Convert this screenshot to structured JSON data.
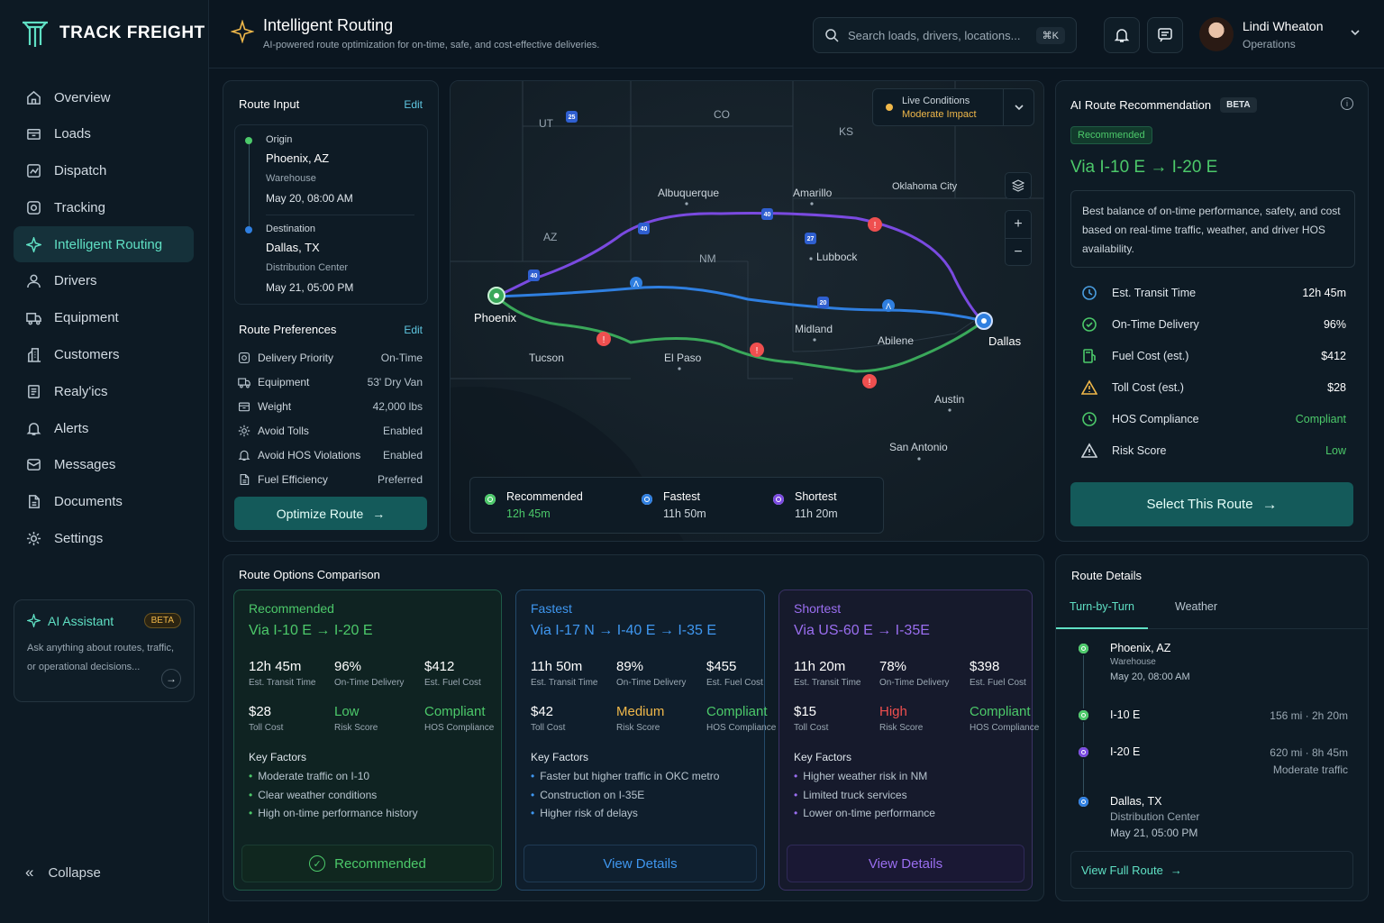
{
  "brand": {
    "name": "TRACK FREIGHT"
  },
  "sidebar": {
    "items": [
      {
        "label": "Overview",
        "icon": "home-icon"
      },
      {
        "label": "Loads",
        "icon": "box-icon"
      },
      {
        "label": "Dispatch",
        "icon": "dispatch-icon"
      },
      {
        "label": "Tracking",
        "icon": "target-icon"
      },
      {
        "label": "Intelligent Routing",
        "icon": "sparkle-icon",
        "active": true
      },
      {
        "label": "Drivers",
        "icon": "users-icon"
      },
      {
        "label": "Equipment",
        "icon": "truck-icon"
      },
      {
        "label": "Customers",
        "icon": "building-icon"
      },
      {
        "label": "Realy'ics",
        "icon": "report-icon"
      },
      {
        "label": "Alerts",
        "icon": "bell-icon"
      },
      {
        "label": "Messages",
        "icon": "mail-icon"
      },
      {
        "label": "Documents",
        "icon": "document-icon"
      },
      {
        "label": "Settings",
        "icon": "gear-icon"
      }
    ],
    "assistant": {
      "title": "AI Assistant",
      "badge": "BETA",
      "desc": "Ask anything about routes, traffic, or operational decisions..."
    },
    "collapse_label": "Collapse"
  },
  "header": {
    "title": "Intelligent Routing",
    "subtitle": "AI-powered route optimization for on-time, safe, and cost-effective deliveries.",
    "search_placeholder": "Search loads, drivers, locations...",
    "search_shortcut": "⌘K",
    "user": {
      "name": "Lindi Wheaton",
      "role": "Operations"
    }
  },
  "route_input": {
    "title": "Route Input",
    "edit": "Edit",
    "origin": {
      "label": "Origin",
      "city": "Phoenix, AZ",
      "type": "Warehouse",
      "time": "May 20, 08:00 AM"
    },
    "destination": {
      "label": "Destination",
      "city": "Dallas, TX",
      "type": "Distribution Center",
      "time": "May 21, 05:00 PM"
    }
  },
  "preferences": {
    "title": "Route Preferences",
    "edit": "Edit",
    "rows": [
      {
        "label": "Delivery Priority",
        "value": "On-Time"
      },
      {
        "label": "Equipment",
        "value": "53' Dry Van"
      },
      {
        "label": "Weight",
        "value": "42,000 lbs"
      },
      {
        "label": "Avoid Tolls",
        "value": "Enabled"
      },
      {
        "label": "Avoid HOS Violations",
        "value": "Enabled"
      },
      {
        "label": "Fuel Efficiency",
        "value": "Preferred"
      }
    ],
    "button": "Optimize Route"
  },
  "map": {
    "live": {
      "title": "Live Conditions",
      "status": "Moderate Impact"
    },
    "states": [
      "UT",
      "CO",
      "KS",
      "AZ",
      "NM"
    ],
    "cities": [
      "Phoenix",
      "Dallas",
      "Albuquerque",
      "Amarillo",
      "Oklahoma City",
      "Lubbock",
      "Midland",
      "Abilene",
      "Tucson",
      "El Paso",
      "Austin",
      "San Antonio"
    ],
    "highways": [
      "25",
      "40",
      "40",
      "27",
      "40",
      "20"
    ],
    "legend": [
      {
        "name": "Recommended",
        "time": "12h 45m",
        "color": "#4cc96a"
      },
      {
        "name": "Fastest",
        "time": "11h 50m",
        "color": "#2f7fe0"
      },
      {
        "name": "Shortest",
        "time": "11h 20m",
        "color": "#7a4ae0"
      }
    ]
  },
  "recommendation": {
    "title": "AI Route Recommendation",
    "badge": "BETA",
    "tag": "Recommended",
    "route": "Via I-10 E → I-20 E",
    "desc": "Best balance of on-time performance, safety, and cost based on real-time traffic, weather, and driver HOS availability.",
    "metrics": [
      {
        "label": "Est. Transit Time",
        "value": "12h 45m",
        "icon": "clock-icon",
        "color": "#4a9ee0",
        "vcolor": "#ffffff"
      },
      {
        "label": "On-Time Delivery",
        "value": "96%",
        "icon": "check-circle-icon",
        "color": "#4cc96a",
        "vcolor": "#ffffff"
      },
      {
        "label": "Fuel Cost (est.)",
        "value": "$412",
        "icon": "fuel-icon",
        "color": "#4cc96a",
        "vcolor": "#ffffff"
      },
      {
        "label": "Toll Cost (est.)",
        "value": "$28",
        "icon": "warning-icon",
        "color": "#f0b84a",
        "vcolor": "#ffffff"
      },
      {
        "label": "HOS Compliance",
        "value": "Compliant",
        "icon": "clock-icon",
        "color": "#4cc96a",
        "vcolor": "#4cc96a"
      },
      {
        "label": "Risk Score",
        "value": "Low",
        "icon": "warning-icon",
        "color": "#cdd6dd",
        "vcolor": "#4cc96a"
      }
    ],
    "button": "Select This Route"
  },
  "comparison": {
    "title": "Route Options Comparison",
    "options": [
      {
        "label": "Recommended",
        "route": "Via I-10 E → I-20 E",
        "stats": [
          {
            "value": "12h 45m",
            "label": "Est. Transit Time",
            "color": "#ffffff"
          },
          {
            "value": "96%",
            "label": "On-Time Delivery",
            "color": "#ffffff"
          },
          {
            "value": "$412",
            "label": "Est. Fuel Cost",
            "color": "#ffffff"
          },
          {
            "value": "$28",
            "label": "Toll Cost",
            "color": "#ffffff"
          },
          {
            "value": "Low",
            "label": "Risk Score",
            "color": "#4cc96a"
          },
          {
            "value": "Compliant",
            "label": "HOS Compliance",
            "color": "#4cc96a"
          }
        ],
        "key_title": "Key Factors",
        "factors": [
          "Moderate traffic on I-10",
          "Clear weather conditions",
          "High on-time performance history"
        ],
        "button": "Recommended"
      },
      {
        "label": "Fastest",
        "route": "Via I-17 N → I-40 E → I-35 E",
        "stats": [
          {
            "value": "11h 50m",
            "label": "Est. Transit Time",
            "color": "#ffffff"
          },
          {
            "value": "89%",
            "label": "On-Time Delivery",
            "color": "#ffffff"
          },
          {
            "value": "$455",
            "label": "Est. Fuel Cost",
            "color": "#ffffff"
          },
          {
            "value": "$42",
            "label": "Toll Cost",
            "color": "#ffffff"
          },
          {
            "value": "Medium",
            "label": "Risk Score",
            "color": "#f0b84a"
          },
          {
            "value": "Compliant",
            "label": "HOS Compliance",
            "color": "#4cc96a"
          }
        ],
        "key_title": "Key Factors",
        "factors": [
          "Faster but higher traffic in OKC metro",
          "Construction on I-35E",
          "Higher risk of delays"
        ],
        "button": "View Details"
      },
      {
        "label": "Shortest",
        "route": "Via US-60 E → I-35E",
        "stats": [
          {
            "value": "11h 20m",
            "label": "Est. Transit Time",
            "color": "#ffffff"
          },
          {
            "value": "78%",
            "label": "On-Time Delivery",
            "color": "#ffffff"
          },
          {
            "value": "$398",
            "label": "Est. Fuel Cost",
            "color": "#ffffff"
          },
          {
            "value": "$15",
            "label": "Toll Cost",
            "color": "#ffffff"
          },
          {
            "value": "High",
            "label": "Risk Score",
            "color": "#ef4f4f"
          },
          {
            "value": "Compliant",
            "label": "HOS Compliance",
            "color": "#4cc96a"
          }
        ],
        "key_title": "Key Factors",
        "factors": [
          "Higher weather risk in NM",
          "Limited truck services",
          "Lower on-time performance"
        ],
        "button": "View Details"
      }
    ]
  },
  "route_details": {
    "title": "Route Details",
    "tabs": [
      "Turn-by-Turn",
      "Weather"
    ],
    "stops": [
      {
        "name": "Phoenix, AZ",
        "sub": "Warehouse",
        "time": "May 20, 08:00 AM",
        "right": "",
        "right2": "",
        "color": "#4cc96a"
      },
      {
        "name": "I-10 E",
        "sub": "",
        "time": "",
        "right": "156 mi · 2h 20m",
        "right2": "",
        "color": "#4cc96a"
      },
      {
        "name": "I-20 E",
        "sub": "",
        "time": "",
        "right": "620 mi · 8h 45m",
        "right2": "Moderate traffic",
        "color": "#7a4ae0"
      },
      {
        "name": "Dallas, TX",
        "sub": "Distribution Center",
        "time": "May 21, 05:00 PM",
        "right": "",
        "right2": "",
        "color": "#2f7fe0"
      }
    ],
    "link": "View Full Route"
  },
  "colors": {
    "accent": "#5fe0c4",
    "recommended": "#4cc96a",
    "fastest": "#2f7fe0",
    "shortest": "#7a4ae0",
    "warning": "#f0b84a",
    "danger": "#ef4f4f"
  }
}
